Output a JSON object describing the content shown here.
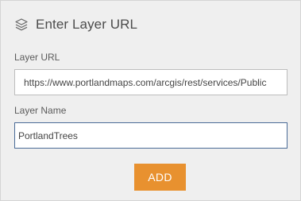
{
  "header": {
    "icon": "layers-icon",
    "title": "Enter Layer URL"
  },
  "layer_url": {
    "label": "Layer URL",
    "value": "https://www.portlandmaps.com/arcgis/rest/services/Public"
  },
  "layer_name": {
    "label": "Layer Name",
    "value": "PortlandTrees"
  },
  "actions": {
    "add_label": "ADD"
  },
  "colors": {
    "panel_background": "#efefef",
    "accent_orange": "#e8912f",
    "focus_border": "#4a6b97",
    "text": "#4c4c4c"
  }
}
